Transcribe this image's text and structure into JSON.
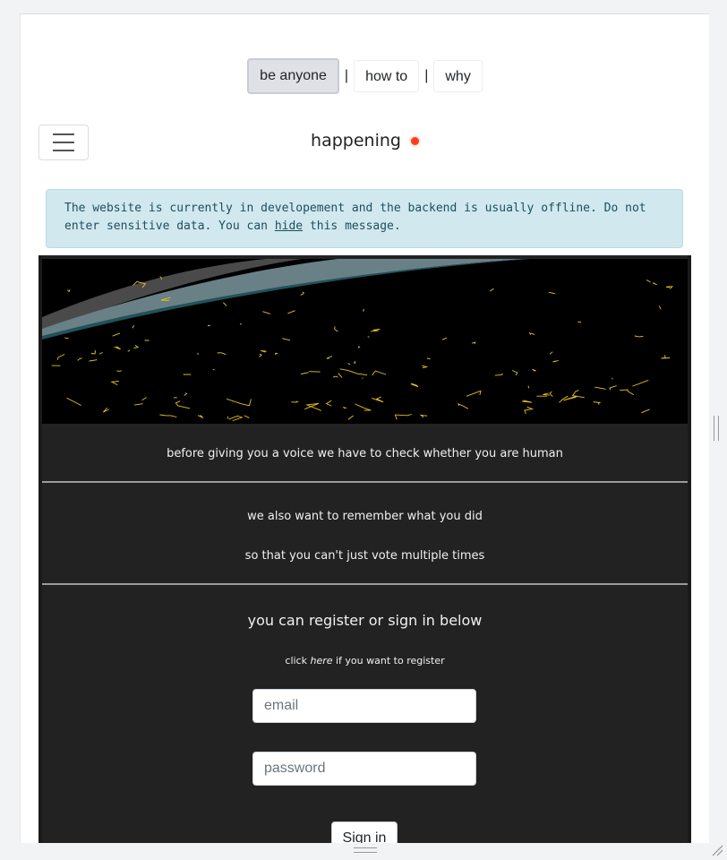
{
  "nav": {
    "tabs": [
      {
        "label": "be anyone",
        "active": true
      },
      {
        "label": "how to",
        "active": false
      },
      {
        "label": "why",
        "active": false
      }
    ],
    "separator": "|"
  },
  "header": {
    "menu_icon": "hamburger-icon",
    "title": "happening",
    "live_indicator_color": "#ff3d1f"
  },
  "alert": {
    "text_before": "The website is currently in developement and the backend is usually offline. Do not enter sensitive data. You can ",
    "link": "hide",
    "text_after": " this message."
  },
  "panel": {
    "banner_icon": "starfield-banner",
    "human_check": "before giving you a voice we have to check whether you are human",
    "remember_line1": "we also want to remember what you did",
    "remember_line2": "so that you can't just vote multiple times",
    "heading": "you can register or sign in below",
    "register_prefix": "click ",
    "register_link": "here",
    "register_suffix": " if you want to register",
    "email_placeholder": "email",
    "password_placeholder": "password",
    "signin_label": "Sign in"
  },
  "colors": {
    "alert_bg": "#d1e8ee",
    "panel_bg": "#222222",
    "trail_color": "#e8c21a"
  }
}
